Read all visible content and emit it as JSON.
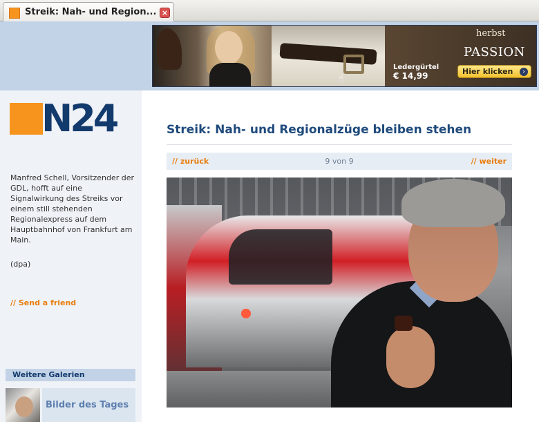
{
  "browser": {
    "tab_title": "Streik: Nah- und Region...",
    "close_glyph": "×"
  },
  "banner": {
    "product_label": "Ledergürtel",
    "price": "€ 14,99",
    "brand_line1": "herbst",
    "brand_line2": "PASSION",
    "cta_label": "Hier klicken",
    "cta_arrow": "›"
  },
  "logo": {
    "text": "N24",
    "accent_color": "#f7941d",
    "brand_color": "#133a6c"
  },
  "sidebar": {
    "caption": "Manfred Schell, Vorsitzender der GDL, hofft auf eine Signalwirkung des Streiks vor einem still stehenden Regionalexpress auf dem Hauptbahnhof von Frankfurt am Main.",
    "credit": "(dpa)",
    "send_friend": "// Send a friend",
    "more_galleries_title": "Weitere Galerien",
    "gallery_link": "Bilder des Tages"
  },
  "article": {
    "headline": "Streik: Nah- und Regionalzüge bleiben stehen",
    "prev_label": "// zurück",
    "counter": "9 von 9",
    "next_label": "// weiter"
  }
}
